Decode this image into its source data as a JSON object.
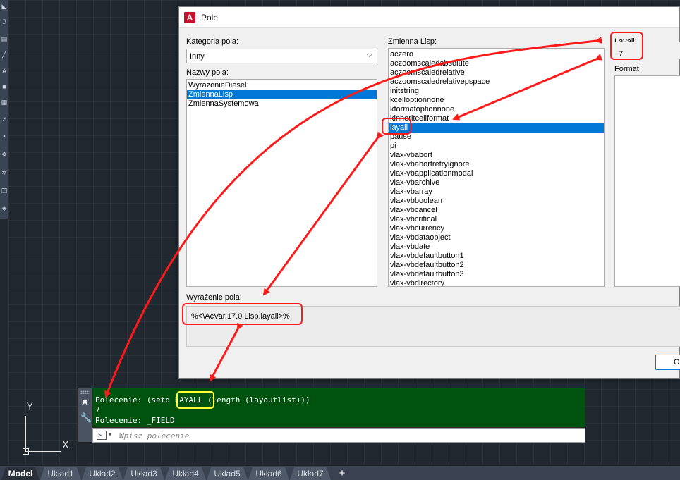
{
  "dialog": {
    "title": "Pole",
    "app_icon": "autocad-a-icon",
    "category_label": "Kategoria pola:",
    "category_value": "Inny",
    "field_names_label": "Nazwy pola:",
    "field_names": [
      {
        "label": "WyrażenieDiesel",
        "selected": false
      },
      {
        "label": "ZmiennaLisp",
        "selected": true
      },
      {
        "label": "ZmiennaSystemowa",
        "selected": false
      }
    ],
    "lisp_variable_label": "Zmienna Lisp:",
    "lisp_variables": [
      {
        "label": "aczero",
        "selected": false
      },
      {
        "label": "aczoomscaledabsolute",
        "selected": false
      },
      {
        "label": "aczoomscaledrelative",
        "selected": false
      },
      {
        "label": "aczoomscaledrelativepspace",
        "selected": false
      },
      {
        "label": "initstring",
        "selected": false
      },
      {
        "label": "kcelloptionnone",
        "selected": false
      },
      {
        "label": "kformatoptionnone",
        "selected": false
      },
      {
        "label": "kinheritcellformat",
        "selected": false
      },
      {
        "label": "layall",
        "selected": true
      },
      {
        "label": "pause",
        "selected": false
      },
      {
        "label": "pi",
        "selected": false
      },
      {
        "label": "vlax-vbabort",
        "selected": false
      },
      {
        "label": "vlax-vbabortretryignore",
        "selected": false
      },
      {
        "label": "vlax-vbapplicationmodal",
        "selected": false
      },
      {
        "label": "vlax-vbarchive",
        "selected": false
      },
      {
        "label": "vlax-vbarray",
        "selected": false
      },
      {
        "label": "vlax-vbboolean",
        "selected": false
      },
      {
        "label": "vlax-vbcancel",
        "selected": false
      },
      {
        "label": "vlax-vbcritical",
        "selected": false
      },
      {
        "label": "vlax-vbcurrency",
        "selected": false
      },
      {
        "label": "vlax-vbdataobject",
        "selected": false
      },
      {
        "label": "vlax-vbdate",
        "selected": false
      },
      {
        "label": "vlax-vbdefaultbutton1",
        "selected": false
      },
      {
        "label": "vlax-vbdefaultbutton2",
        "selected": false
      },
      {
        "label": "vlax-vbdefaultbutton3",
        "selected": false
      },
      {
        "label": "vlax-vbdirectory",
        "selected": false
      }
    ],
    "value_label": "Layall:",
    "value": "7",
    "format_label": "Format:",
    "expression_label": "Wyrażenie pola:",
    "expression": "%<\\AcVar.17.0 Lisp.layall>%",
    "ok_label": "OK"
  },
  "command": {
    "history_prefix": "Polecenie: (setq ",
    "highlight": "LAYALL",
    "history_suffix": " (length (layoutlist)))",
    "result": "7",
    "history_2": "Polecenie: _FIELD",
    "placeholder": "Wpisz polecenie",
    "close_icon": "close-icon",
    "customize_icon": "wrench-icon"
  },
  "ucs": {
    "x_label": "X",
    "y_label": "Y"
  },
  "layout_tabs": [
    {
      "label": "Model",
      "active": true
    },
    {
      "label": "Układ1",
      "active": false
    },
    {
      "label": "Układ2",
      "active": false
    },
    {
      "label": "Układ3",
      "active": false
    },
    {
      "label": "Układ4",
      "active": false
    },
    {
      "label": "Układ5",
      "active": false
    },
    {
      "label": "Układ6",
      "active": false
    },
    {
      "label": "Układ7",
      "active": false
    }
  ],
  "add_tab_label": "+",
  "colors": {
    "annotation_red": "#ff1a1a",
    "annotation_yellow": "#ffff33",
    "selection_blue": "#0078d7",
    "command_bg": "#00520f"
  }
}
